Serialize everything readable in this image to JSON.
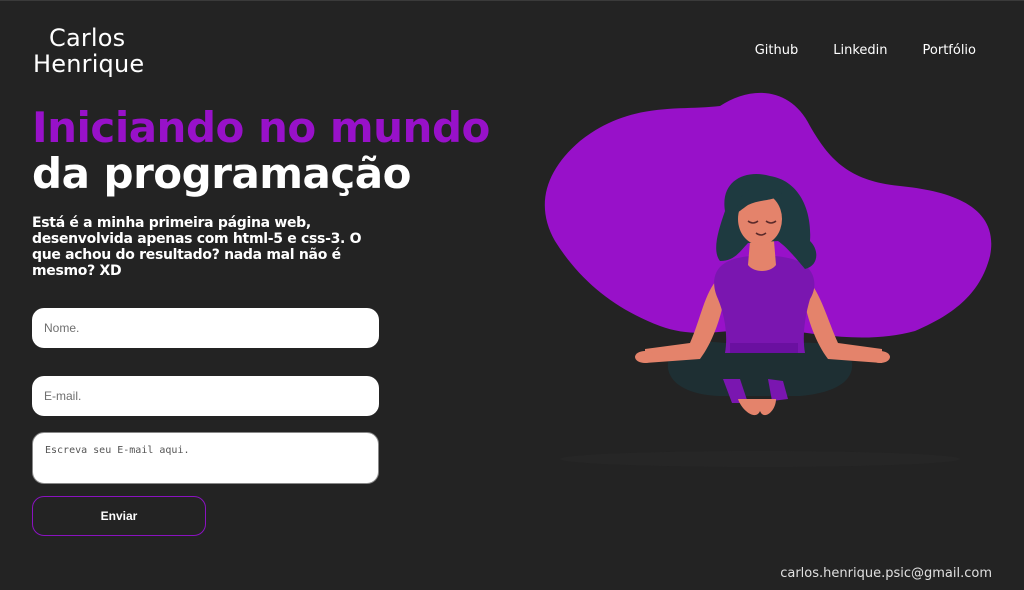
{
  "header": {
    "logo_line1": "Carlos",
    "logo_line2": "Henrique",
    "nav": [
      {
        "label": "Github"
      },
      {
        "label": "Linkedin"
      },
      {
        "label": "Portfólio"
      }
    ]
  },
  "hero": {
    "title_line1": "Iniciando no mundo",
    "title_line2": "da programação",
    "description": "Está é a minha primeira página web, desenvolvida apenas com html-5 e css-3. O que achou do resultado? nada mal não é mesmo? XD"
  },
  "form": {
    "name_placeholder": "Nome.",
    "email_placeholder": "E-mail.",
    "message_placeholder": "Escreva seu E-mail aqui.",
    "submit_label": "Enviar"
  },
  "footer": {
    "email": "carlos.henrique.psic@gmail.com"
  },
  "colors": {
    "background": "#232323",
    "accent_purple": "#9811c9"
  },
  "illustration": {
    "icon": "meditating-woman-illustration"
  }
}
